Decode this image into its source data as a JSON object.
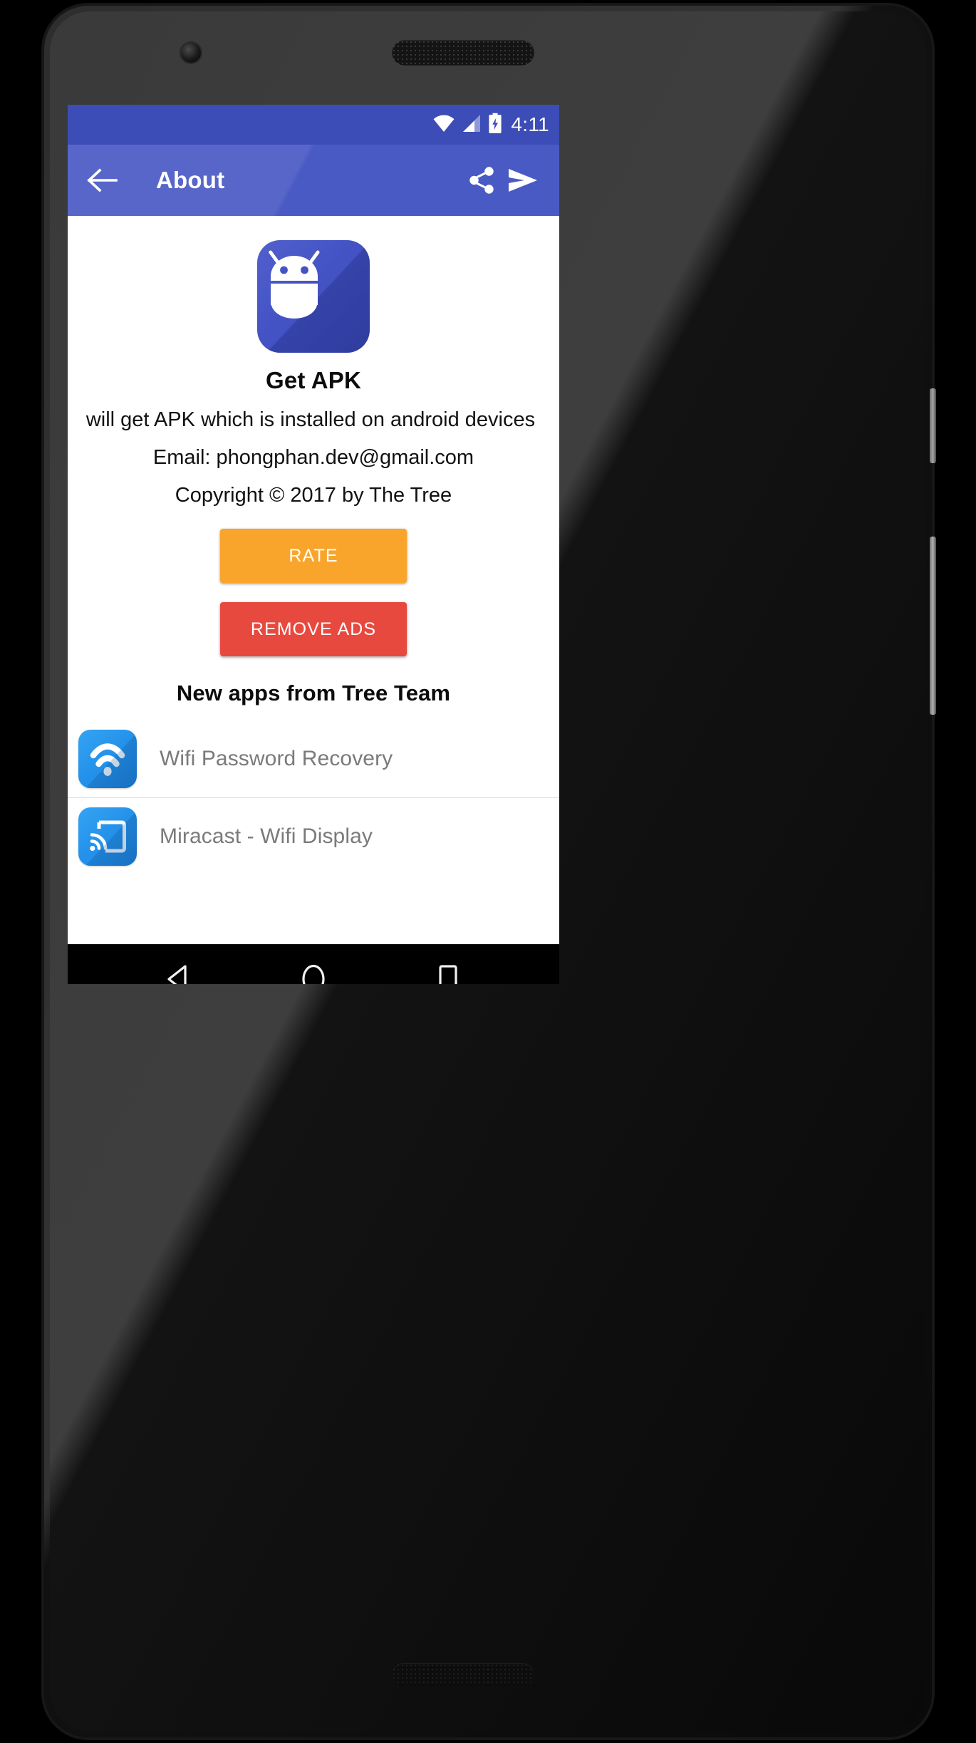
{
  "status_bar": {
    "clock": "4:11",
    "icons": [
      "wifi-icon",
      "cellular-signal-icon",
      "battery-charging-icon"
    ],
    "background_color": "#3D4DB7"
  },
  "app_bar": {
    "back_label": "back-arrow-icon",
    "title": "About",
    "share_label": "share-icon",
    "send_label": "send-icon",
    "background_color": "#4A5AC4"
  },
  "content": {
    "app_icon": "android-robot-icon",
    "app_title": "Get APK",
    "description": "will get APK which is installed on android devices",
    "email": "Email: phongphan.dev@gmail.com",
    "copyright": "Copyright © 2017 by The Tree",
    "rate_button": "RATE",
    "rate_button_color": "#F9A52C",
    "remove_ads_button": "REMOVE ADS",
    "remove_ads_button_color": "#E8493F",
    "new_apps_heading": "New apps from Tree Team",
    "new_apps": [
      {
        "icon": "wifi-signal-icon",
        "label": "Wifi Password Recovery"
      },
      {
        "icon": "screen-cast-icon",
        "label": "Miracast - Wifi Display"
      }
    ]
  },
  "nav_bar": {
    "back": "nav-back-triangle-icon",
    "home": "nav-home-circle-icon",
    "recents": "nav-recents-square-icon"
  }
}
